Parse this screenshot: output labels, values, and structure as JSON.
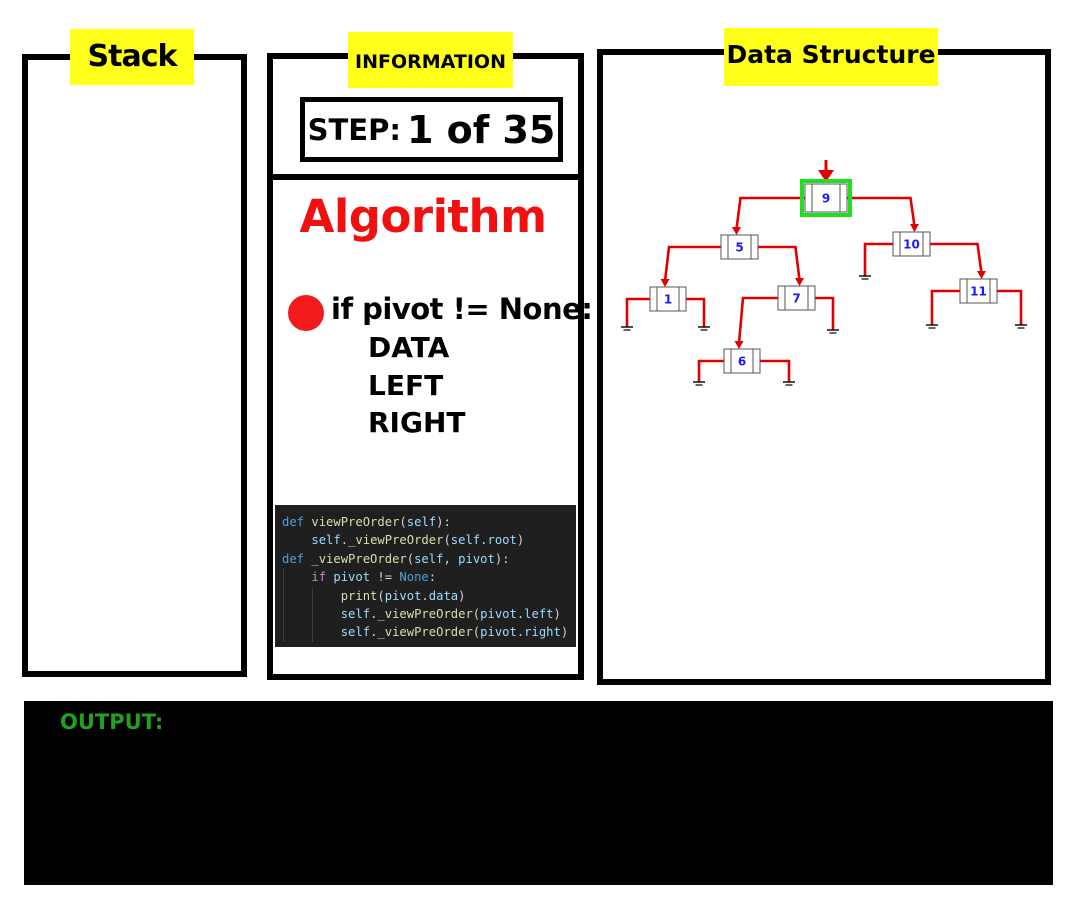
{
  "panels": {
    "stack": {
      "title": "Stack"
    },
    "information": {
      "title": "INFORMATION",
      "step_label": "STEP:",
      "step_value": "1 of 35"
    },
    "data_structure": {
      "title": "Data Structure"
    },
    "output": {
      "label": "OUTPUT:",
      "text": ""
    }
  },
  "algorithm": {
    "title": "Algorithm",
    "lines": [
      "if pivot != None:",
      "DATA",
      "LEFT",
      "RIGHT"
    ],
    "current_line": 1
  },
  "code": {
    "lines": [
      [
        [
          "kw",
          "def "
        ],
        [
          "fn",
          "viewPreOrder"
        ],
        [
          "pl",
          "("
        ],
        [
          "vr",
          "self"
        ],
        [
          "pl",
          "):"
        ]
      ],
      [
        [
          "pl",
          "    "
        ],
        [
          "vr",
          "self"
        ],
        [
          "pl",
          "."
        ],
        [
          "fn",
          "_viewPreOrder"
        ],
        [
          "pl",
          "("
        ],
        [
          "vr",
          "self"
        ],
        [
          "pl",
          "."
        ],
        [
          "vr",
          "root"
        ],
        [
          "pl",
          ")"
        ]
      ],
      [
        [
          "kw",
          "def "
        ],
        [
          "fn",
          "_viewPreOrder"
        ],
        [
          "pl",
          "("
        ],
        [
          "vr",
          "self"
        ],
        [
          "pl",
          ", "
        ],
        [
          "vr",
          "pivot"
        ],
        [
          "pl",
          "):"
        ]
      ],
      [
        [
          "pl",
          "    "
        ],
        [
          "kw2",
          "if "
        ],
        [
          "vr",
          "pivot"
        ],
        [
          "pl",
          " != "
        ],
        [
          "kw",
          "None"
        ],
        [
          "pl",
          ":"
        ]
      ],
      [
        [
          "pl",
          "        "
        ],
        [
          "fn",
          "print"
        ],
        [
          "pl",
          "("
        ],
        [
          "vr",
          "pivot"
        ],
        [
          "pl",
          "."
        ],
        [
          "vr",
          "data"
        ],
        [
          "pl",
          ")"
        ]
      ],
      [
        [
          "pl",
          "        "
        ],
        [
          "vr",
          "self"
        ],
        [
          "pl",
          "."
        ],
        [
          "fn",
          "_viewPreOrder"
        ],
        [
          "pl",
          "("
        ],
        [
          "vr",
          "pivot"
        ],
        [
          "pl",
          "."
        ],
        [
          "vr",
          "left"
        ],
        [
          "pl",
          ")"
        ]
      ],
      [
        [
          "pl",
          "        "
        ],
        [
          "vr",
          "self"
        ],
        [
          "pl",
          "."
        ],
        [
          "fn",
          "_viewPreOrder"
        ],
        [
          "pl",
          "("
        ],
        [
          "vr",
          "pivot"
        ],
        [
          "pl",
          "."
        ],
        [
          "vr",
          "right"
        ],
        [
          "pl",
          ")"
        ]
      ]
    ]
  },
  "tree": {
    "current_node": "9",
    "nodes": [
      {
        "id": "9",
        "value": "9",
        "left": "5",
        "right": "10"
      },
      {
        "id": "5",
        "value": "5",
        "left": "1",
        "right": "7"
      },
      {
        "id": "10",
        "value": "10",
        "left": null,
        "right": "11"
      },
      {
        "id": "1",
        "value": "1",
        "left": null,
        "right": null
      },
      {
        "id": "7",
        "value": "7",
        "left": "6",
        "right": null
      },
      {
        "id": "11",
        "value": "11",
        "left": null,
        "right": null
      },
      {
        "id": "6",
        "value": "6",
        "left": null,
        "right": null
      }
    ]
  },
  "colors": {
    "label_bg": "#ffff1a",
    "algorithm_title": "#f01010",
    "pointer": "#f21a1a",
    "edge": "#e00000",
    "node_text": "#1a1aff",
    "current_node_highlight": "#22dd22",
    "output_label": "#22a020",
    "output_bg": "#000000"
  }
}
